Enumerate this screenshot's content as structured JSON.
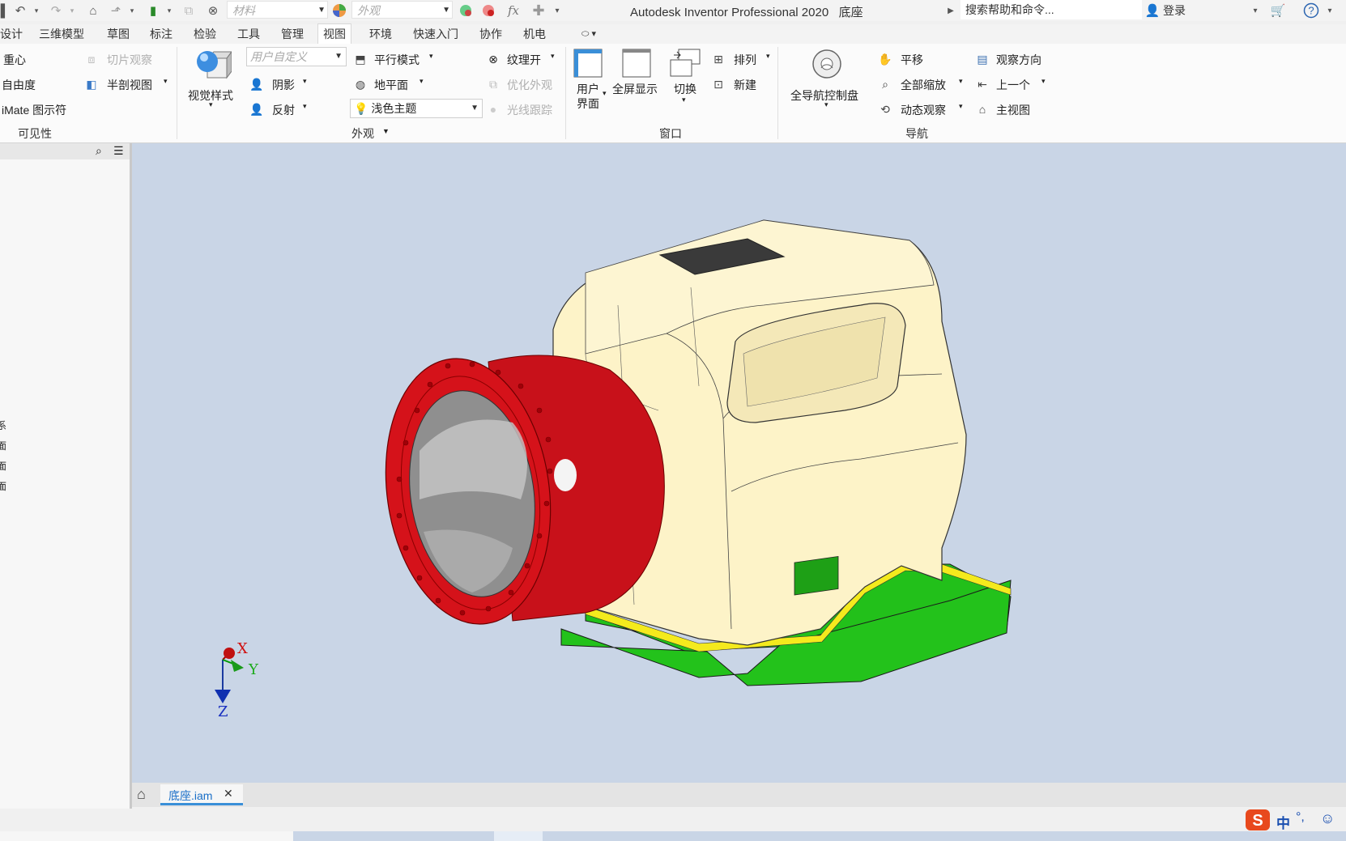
{
  "app": {
    "title": "Autodesk Inventor Professional 2020",
    "document_name": "底座",
    "search_placeholder": "搜索帮助和命令...",
    "login_label": "登录"
  },
  "quick_access": {
    "material_placeholder": "材料",
    "appearance_placeholder": "外观",
    "icons": [
      "undo-icon",
      "redo-icon",
      "home-icon",
      "select-icon",
      "update-icon",
      "measure-icon",
      "material-icon",
      "appearance-icon",
      "fx-icon",
      "plus-icon"
    ]
  },
  "tabs": [
    {
      "label": "设计"
    },
    {
      "label": "三维模型"
    },
    {
      "label": "草图"
    },
    {
      "label": "标注"
    },
    {
      "label": "检验"
    },
    {
      "label": "工具"
    },
    {
      "label": "管理"
    },
    {
      "label": "视图",
      "active": true
    },
    {
      "label": "环境"
    },
    {
      "label": "快速入门"
    },
    {
      "label": "协作"
    },
    {
      "label": "机电"
    }
  ],
  "ribbon": {
    "visibility": {
      "items": [
        "重心",
        "自由度",
        "iMate 图示符"
      ],
      "slice_label": "切片观察",
      "half_section_label": "半剖视图",
      "panel_label": "可见性"
    },
    "appearance": {
      "visual_style_label": "视觉样式",
      "user_defined_placeholder": "用户自定义",
      "shadow_label": "阴影",
      "reflection_label": "反射",
      "parallel_mode_label": "平行模式",
      "ground_plane_label": "地平面",
      "theme_value": "浅色主题",
      "texture_on_label": "纹理开",
      "optimize_label": "优化外观",
      "ray_trace_label": "光线跟踪",
      "panel_label": "外观"
    },
    "window": {
      "user_interface_label_1": "用户",
      "user_interface_label_2": "界面",
      "fullscreen_label": "全屏显示",
      "switch_label": "切换",
      "arrange_label": "排列",
      "new_label": "新建",
      "panel_label": "窗口"
    },
    "navigation": {
      "full_nav_wheel_label": "全导航控制盘",
      "pan_label": "平移",
      "zoom_all_label": "全部缩放",
      "orbit_label": "动态观察",
      "look_at_label": "观察方向",
      "previous_label": "上一个",
      "home_view_label": "主视图",
      "panel_label": "导航"
    }
  },
  "browser_panel": {
    "partial_labels": [
      "系",
      "面",
      "面",
      "面"
    ]
  },
  "viewcube": {
    "x_label": "X",
    "y_label": "Y",
    "z_label": "Z"
  },
  "document_tab": {
    "label": "底座.iam",
    "close": "✕"
  },
  "status": {
    "ime_label": "中",
    "ime_extra": "°,"
  },
  "colors": {
    "viewport_bg": "#c9d5e6",
    "body_cream": "#fdf3c8",
    "base_green": "#22c01a",
    "base_yellow": "#f4ea1d",
    "head_red": "#d5121a",
    "accent_blue": "#3a8fd8"
  }
}
